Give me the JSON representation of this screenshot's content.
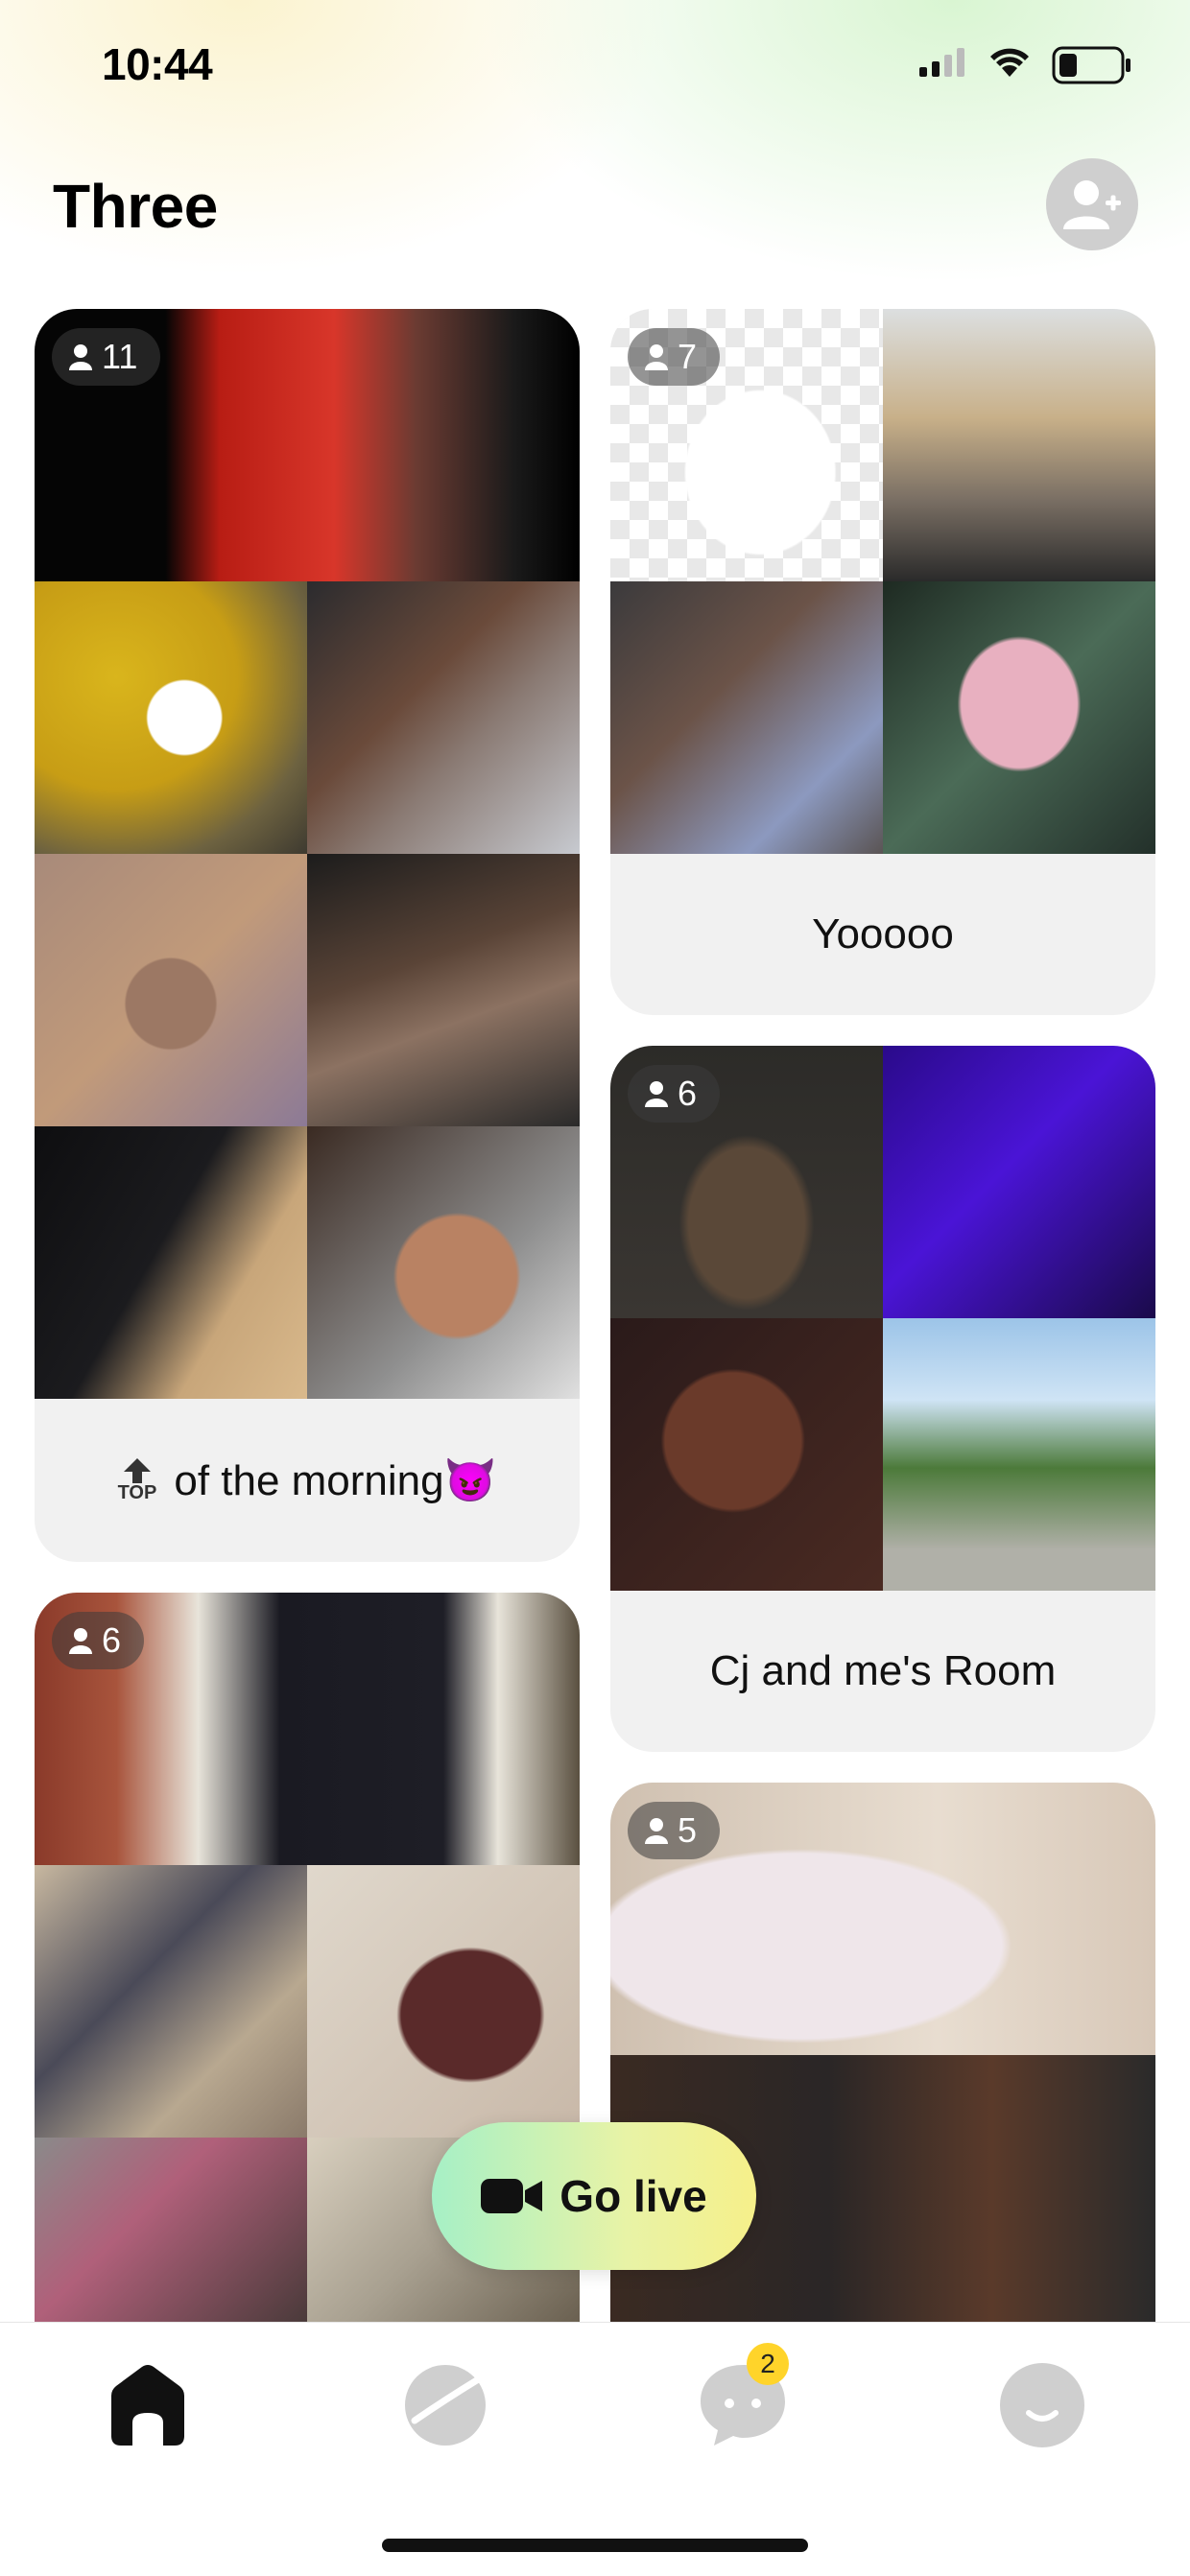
{
  "status_bar": {
    "time": "10:44"
  },
  "header": {
    "title": "Three"
  },
  "rooms": [
    {
      "member_count": "11",
      "name": "of the morning😈",
      "top_label": "TOP"
    },
    {
      "member_count": "7",
      "name": "Yooooo"
    },
    {
      "member_count": "6",
      "name": "Cj and me's Room"
    },
    {
      "member_count": "6",
      "name": ""
    },
    {
      "member_count": "5",
      "name": ""
    }
  ],
  "go_live": {
    "label": "Go live"
  },
  "tab_bar": {
    "items": [
      {
        "icon": "home-icon"
      },
      {
        "icon": "planet-icon"
      },
      {
        "icon": "chat-icon",
        "badge": "2"
      },
      {
        "icon": "profile-icon"
      }
    ]
  },
  "colors": {
    "accent_yellow": "#ffd42a",
    "go_live_start": "#a6f0c6",
    "go_live_end": "#f6f08a"
  }
}
